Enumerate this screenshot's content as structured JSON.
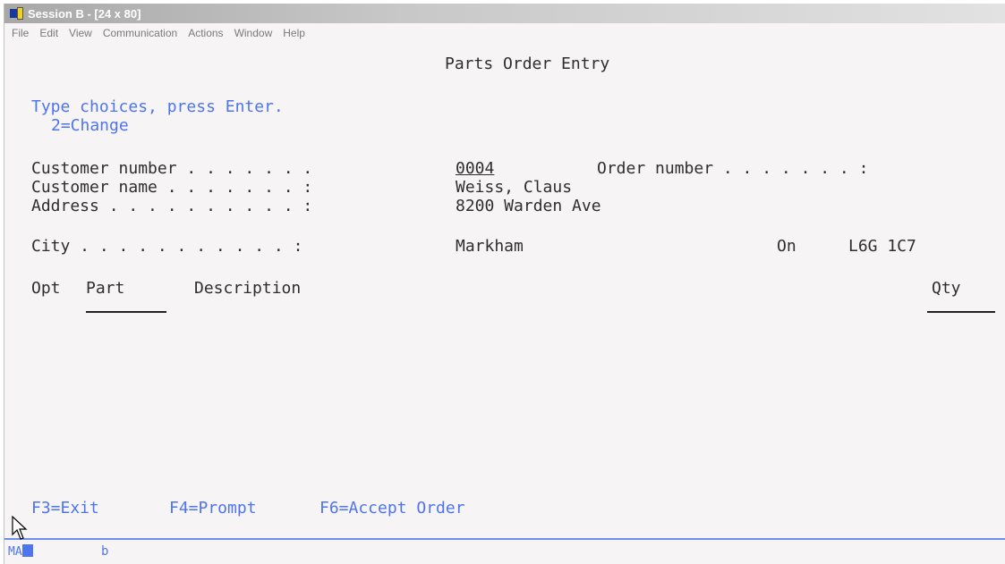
{
  "window": {
    "title": "Session B - [24 x 80]"
  },
  "menubar": [
    "File",
    "Edit",
    "View",
    "Communication",
    "Actions",
    "Window",
    "Help"
  ],
  "screen": {
    "heading": "Parts Order Entry",
    "instruction": "Type choices, press Enter.",
    "option": "2=Change",
    "customer_number_label": "Customer number . . . . . . .",
    "customer_number_value": "0004",
    "order_number_label": "Order number . . . . . . . :",
    "customer_name_label": "Customer name . . . . . . . :",
    "customer_name_value": "Weiss, Claus",
    "address_label": "Address . . . . . . . . . . :",
    "address_value": "8200 Warden Ave",
    "city_label": "City . . . . . . . . . . . :",
    "city_value": "Markham",
    "province_value": "On",
    "postal_value": "L6G 1C7",
    "col_opt": "Opt",
    "col_part": "Part",
    "col_description": "Description",
    "col_qty": "Qty",
    "fkeys": [
      "F3=Exit",
      "F4=Prompt",
      "F6=Accept Order"
    ]
  },
  "status": {
    "mode": "MA",
    "indicator": "b"
  },
  "icons": {
    "app": "session-app-icon",
    "pointer": "mouse-pointer-icon"
  }
}
